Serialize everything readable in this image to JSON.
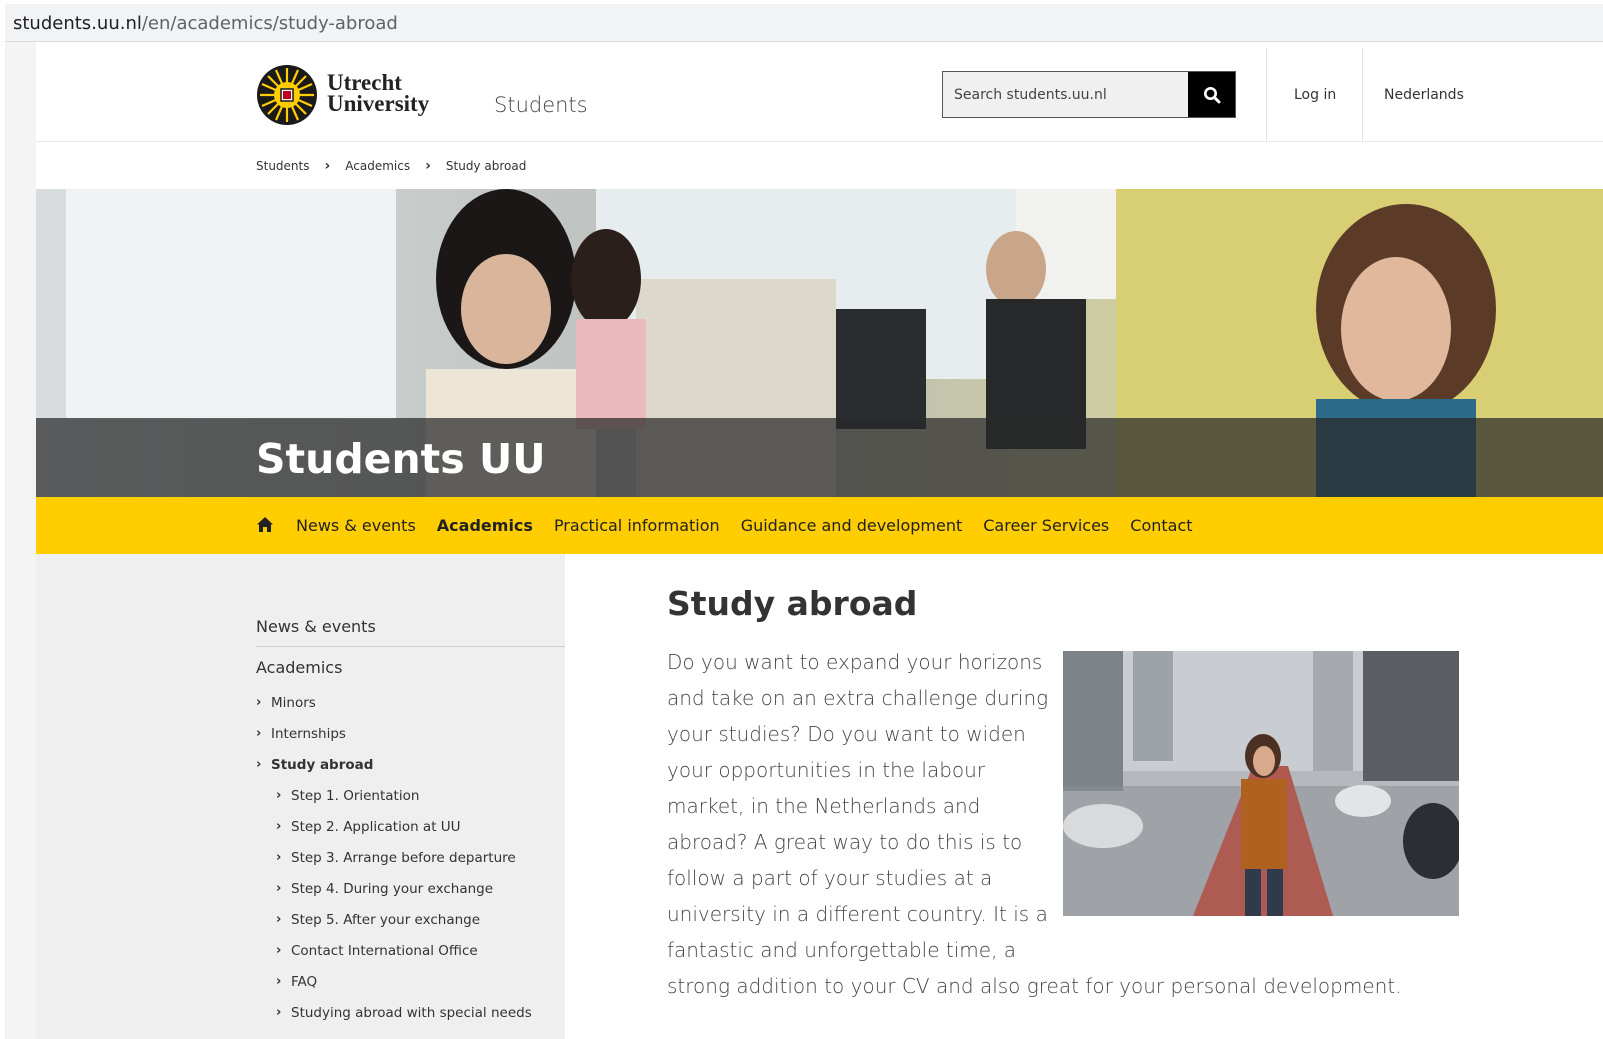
{
  "browser": {
    "url_host": "students.uu.nl",
    "url_path": "/en/academics/study-abroad"
  },
  "header": {
    "logo_line1": "Utrecht",
    "logo_line2": "University",
    "site_name": "Students",
    "search_placeholder": "Search students.uu.nl",
    "login_label": "Log in",
    "language_label": "Nederlands"
  },
  "breadcrumb": [
    "Students",
    "Academics",
    "Study abroad"
  ],
  "hero": {
    "title": "Students UU"
  },
  "main_nav": {
    "items": [
      {
        "label": "News & events",
        "active": false
      },
      {
        "label": "Academics",
        "active": true
      },
      {
        "label": "Practical information",
        "active": false
      },
      {
        "label": "Guidance and development",
        "active": false
      },
      {
        "label": "Career Services",
        "active": false
      },
      {
        "label": "Contact",
        "active": false
      }
    ]
  },
  "sidebar": {
    "heading1": "News & events",
    "heading2": "Academics",
    "items": [
      {
        "label": "Minors"
      },
      {
        "label": "Internships"
      },
      {
        "label": "Study abroad"
      },
      {
        "label": "Step 1. Orientation"
      },
      {
        "label": "Step 2. Application at UU"
      },
      {
        "label": "Step 3. Arrange before departure"
      },
      {
        "label": "Step 4. During your exchange"
      },
      {
        "label": "Step 5. After your exchange"
      },
      {
        "label": "Contact International Office"
      },
      {
        "label": "FAQ"
      },
      {
        "label": "Studying abroad with special needs"
      }
    ]
  },
  "content": {
    "title": "Study abroad",
    "body": "Do you want to expand your horizons and take on an extra challenge during your studies? Do you want to widen your opportunities in the labour market, in the Netherlands and abroad? A great way to do this is to follow a part of your studies at a university in a different country. It is a fantastic and unforgettable time, a strong addition to your CV and also great for your personal development."
  },
  "colors": {
    "brand_yellow": "#ffcd00",
    "search_button": "#000000"
  }
}
